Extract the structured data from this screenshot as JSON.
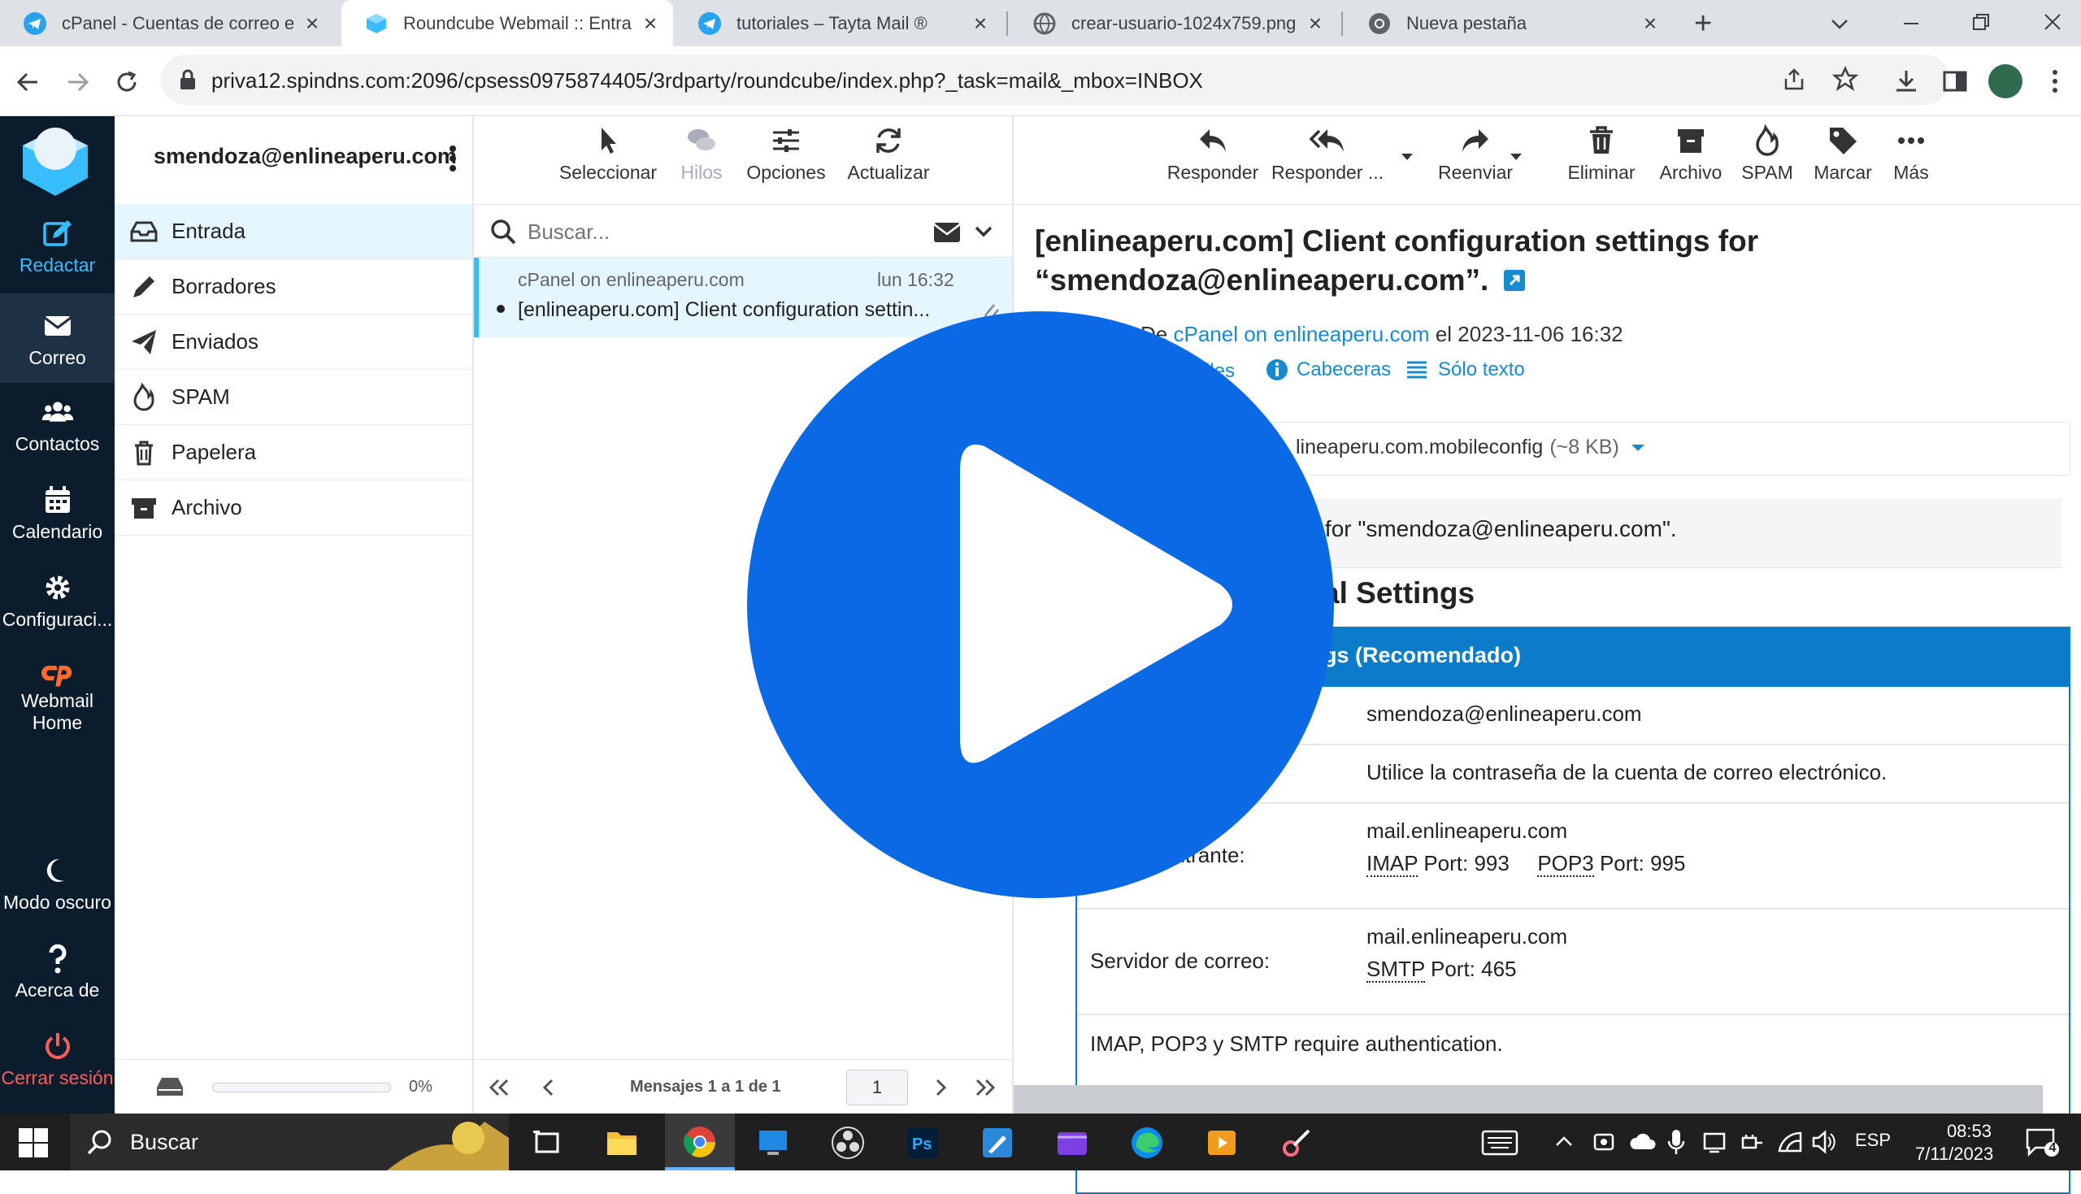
{
  "browser": {
    "tabs": [
      {
        "title": "cPanel - Cuentas de correo e"
      },
      {
        "title": "Roundcube Webmail :: Entra"
      },
      {
        "title": "tutoriales – Tayta Mail ®"
      },
      {
        "title": "crear-usuario-1024x759.png"
      },
      {
        "title": "Nueva pestaña"
      }
    ],
    "url": "priva12.spindns.com:2096/cpsess0975874405/3rdparty/roundcube/index.php?_task=mail&_mbox=INBOX"
  },
  "nav": {
    "compose": "Redactar",
    "mail": "Correo",
    "contacts": "Contactos",
    "calendar": "Calendario",
    "settings": "Configuraci...",
    "webmail_home_1": "Webmail",
    "webmail_home_2": "Home",
    "dark_mode": "Modo oscuro",
    "about": "Acerca de",
    "logout": "Cerrar sesión"
  },
  "account": "smendoza@enlineaperu.com",
  "folders": [
    "Entrada",
    "Borradores",
    "Enviados",
    "SPAM",
    "Papelera",
    "Archivo"
  ],
  "quota": {
    "label": "0%",
    "percent": 0
  },
  "list_toolbar": {
    "select": "Seleccionar",
    "threads": "Hilos",
    "options": "Opciones",
    "refresh": "Actualizar"
  },
  "search": {
    "placeholder": "Buscar..."
  },
  "message": {
    "from": "cPanel on enlineaperu.com",
    "date": "lun 16:32",
    "subject": "[enlineaperu.com] Client configuration settin..."
  },
  "list_footer": {
    "label": "Mensajes 1 a 1 de 1",
    "page": "1"
  },
  "content_toolbar": {
    "reply": "Responder",
    "reply_all": "Responder ...",
    "forward": "Reenviar",
    "delete": "Eliminar",
    "archive": "Archivo",
    "spam": "SPAM",
    "mark": "Marcar",
    "more": "Más"
  },
  "mail": {
    "subject_line1": "[enlineaperu.com] Client configuration settings for",
    "subject_line2": "“smendoza@enlineaperu.com”.",
    "from_prefix": "De",
    "from_name": "cPanel on enlineaperu.com",
    "from_suffix": "el 2023-11-06 16:32",
    "details_partial": "lles",
    "headers": "Cabeceras",
    "plain_text": "Sólo texto",
    "attachment_partial": "lineaperu.com.mobileconfig",
    "attachment_size": "(~8 KB)",
    "body_partial": "ngs for \"smendoza@enlineaperu.com\".",
    "section_partial": "al Settings",
    "table_header_partial": "gs (Recomendado)",
    "username_value": "smendoza@enlineaperu.com",
    "password_value": "Utilice la contraseña de la cuenta de correo electrónico.",
    "incoming_label_partial": "entrante:",
    "incoming_host": "mail.enlineaperu.com",
    "imap_abbr": "IMAP",
    "imap_port": "Port: 993",
    "pop3_abbr": "POP3",
    "pop3_port": "Port: 995",
    "outgoing_label": "Servidor de correo:",
    "outgoing_host": "mail.enlineaperu.com",
    "smtp_abbr": "SMTP",
    "smtp_port": "Port: 465",
    "auth_note": "IMAP, POP3 y SMTP require authentication."
  },
  "taskbar": {
    "search": "Buscar",
    "lang": "ESP",
    "time": "08:53",
    "date": "7/11/2023",
    "notif_count": "4"
  }
}
